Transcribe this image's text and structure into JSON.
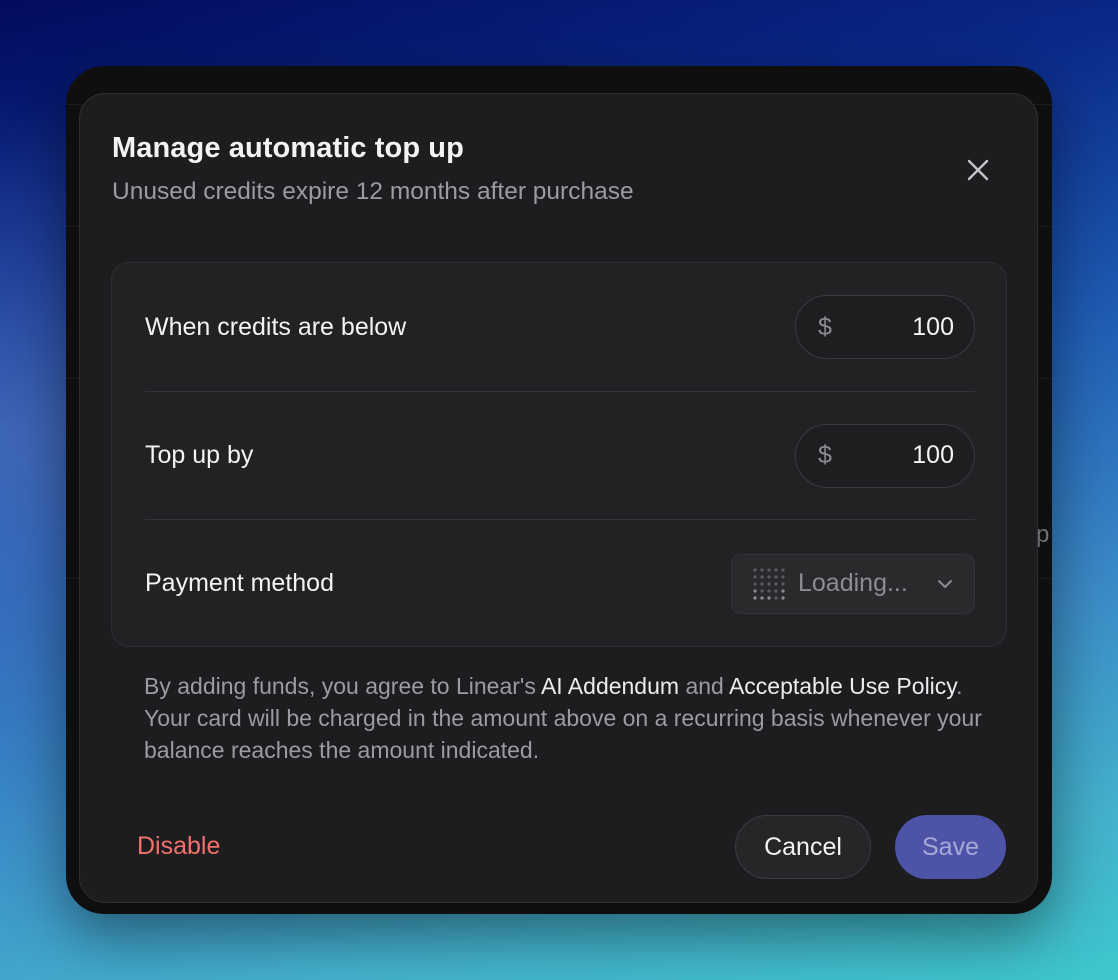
{
  "background_app": {
    "partial_text": "p"
  },
  "dialog": {
    "title": "Manage automatic top up",
    "subtitle": "Unused credits expire 12 months after purchase",
    "close_icon": "close-icon",
    "rows": {
      "threshold": {
        "label": "When credits are below",
        "currency": "$",
        "value": "100"
      },
      "top_up": {
        "label": "Top up by",
        "currency": "$",
        "value": "100"
      },
      "payment": {
        "label": "Payment method",
        "select_value": "Loading...",
        "spinner_icon": "loading-dots-icon",
        "chevron_icon": "chevron-down-icon"
      }
    },
    "legal": {
      "part1": "By adding funds, you agree to Linear's ",
      "link1": "AI Addendum",
      "part2": " and ",
      "link2": "Acceptable Use Policy",
      "part3": ". Your card will be charged in the amount above on a recurring basis whenever your balance reaches the amount indicated."
    },
    "buttons": {
      "disable": "Disable",
      "cancel": "Cancel",
      "save": "Save"
    }
  },
  "colors": {
    "dialog_bg": "#1d1d1f",
    "danger": "#f2716a",
    "accent": "#4d53a6"
  }
}
